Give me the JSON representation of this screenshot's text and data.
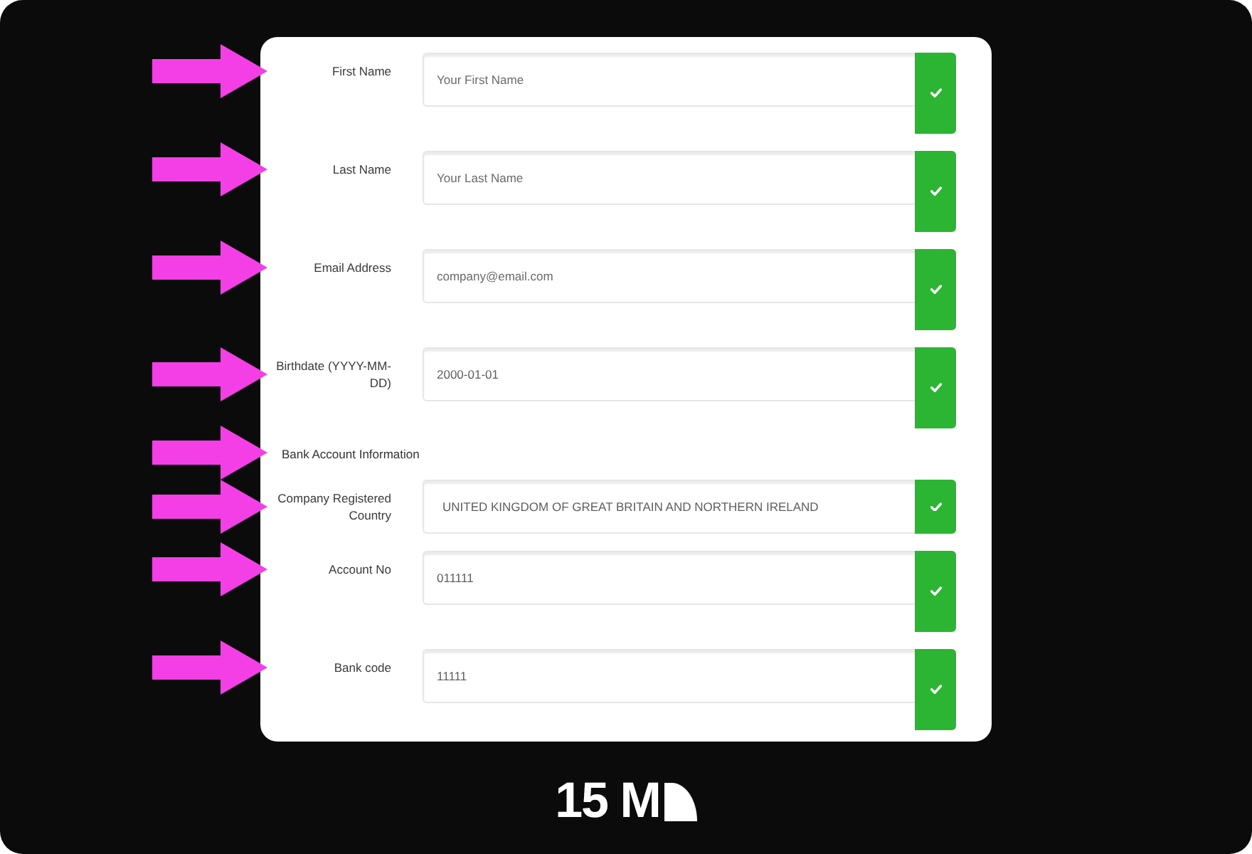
{
  "rows": [
    {
      "kind": "text",
      "label": "First Name",
      "placeholder": "Your First Name",
      "valid": true,
      "pointer": true
    },
    {
      "kind": "text",
      "label": "Last Name",
      "placeholder": "Your Last Name",
      "valid": true,
      "pointer": true
    },
    {
      "kind": "text",
      "label": "Email Address",
      "placeholder": "company@email.com",
      "valid": true,
      "pointer": true
    },
    {
      "kind": "text",
      "label": "Birthdate (YYYY-MM-DD)",
      "value": "2000-01-01",
      "valid": true,
      "pointer": true
    },
    {
      "kind": "heading",
      "label": "Bank Account Information",
      "pointer": true
    },
    {
      "kind": "select",
      "label": "Company Registered Country",
      "value": "UNITED KINGDOM OF GREAT BRITAIN AND NORTHERN IRELAND",
      "valid": true,
      "pointer": true
    },
    {
      "kind": "text",
      "label": "Account No",
      "value": "011111",
      "valid": true,
      "pointer": true
    },
    {
      "kind": "text",
      "label": "Bank code",
      "value": "11111",
      "valid": true,
      "pointer": true
    }
  ],
  "logo": {
    "text": "15 M"
  }
}
